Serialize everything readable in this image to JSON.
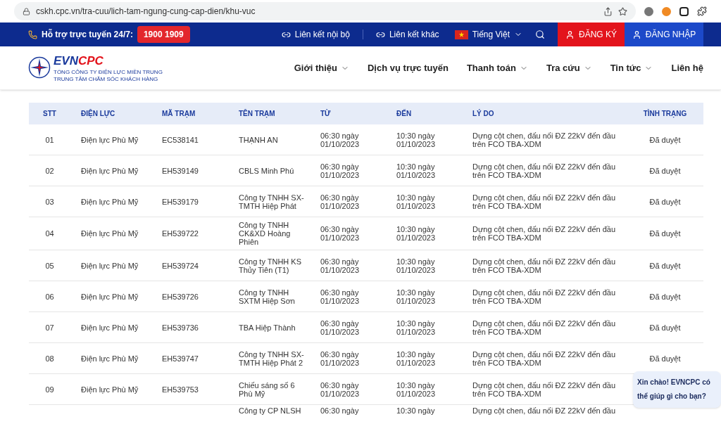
{
  "browser": {
    "url": "cskh.cpc.vn/tra-cuu/lich-tam-ngung-cung-cap-dien/khu-vuc"
  },
  "topbar": {
    "hotline_label": "Hỗ trợ trực tuyến 24/7:",
    "hotline_number": "1900 1909",
    "links": [
      "Liên kết nội bộ",
      "Liên kết khác"
    ],
    "language": "Tiếng Việt",
    "register": "ĐĂNG KÝ",
    "login": "ĐĂNG NHẬP"
  },
  "header": {
    "logo": {
      "brand_a": "EVN",
      "brand_b": "CPC",
      "line1": "TỔNG CÔNG TY ĐIỆN LỰC MIỀN TRUNG",
      "line2": "TRUNG TÂM CHĂM SÓC KHÁCH HÀNG"
    },
    "nav": [
      {
        "label": "Giới thiệu",
        "has_menu": true
      },
      {
        "label": "Dịch vụ trực tuyến",
        "has_menu": false
      },
      {
        "label": "Thanh toán",
        "has_menu": true
      },
      {
        "label": "Tra cứu",
        "has_menu": true
      },
      {
        "label": "Tin tức",
        "has_menu": true
      },
      {
        "label": "Liên hệ",
        "has_menu": false
      }
    ]
  },
  "table": {
    "columns": [
      "STT",
      "ĐIỆN LỰC",
      "MÃ TRẠM",
      "TÊN TRẠM",
      "TỪ",
      "ĐẾN",
      "LÝ DO",
      "TÌNH TRẠNG"
    ],
    "rows": [
      {
        "stt": "01",
        "unit": "Điện lực Phù Mỹ",
        "code": "EC538141",
        "name": "THẠNH AN",
        "from": "06:30 ngày 01/10/2023",
        "to": "10:30 ngày 01/10/2023",
        "reason": "Dựng cột chen, đấu nối ĐZ 22kV đến đầu trên FCO TBA-XDM",
        "status": "Đã duyệt"
      },
      {
        "stt": "02",
        "unit": "Điện lực Phù Mỹ",
        "code": "EH539149",
        "name": "CBLS Minh Phú",
        "from": "06:30 ngày 01/10/2023",
        "to": "10:30 ngày 01/10/2023",
        "reason": "Dựng cột chen, đấu nối ĐZ 22kV đến đầu trên FCO TBA-XDM",
        "status": "Đã duyệt"
      },
      {
        "stt": "03",
        "unit": "Điện lực Phù Mỹ",
        "code": "EH539179",
        "name": "Công ty TNHH SX-TMTH Hiệp Phát",
        "from": "06:30 ngày 01/10/2023",
        "to": "10:30 ngày 01/10/2023",
        "reason": "Dựng cột chen, đấu nối ĐZ 22kV đến đầu trên FCO TBA-XDM",
        "status": "Đã duyệt"
      },
      {
        "stt": "04",
        "unit": "Điện lực Phù Mỹ",
        "code": "EH539722",
        "name": "Công ty TNHH CK&XD Hoàng Phiên",
        "from": "06:30 ngày 01/10/2023",
        "to": "10:30 ngày 01/10/2023",
        "reason": "Dựng cột chen, đấu nối ĐZ 22kV đến đầu trên FCO TBA-XDM",
        "status": "Đã duyệt"
      },
      {
        "stt": "05",
        "unit": "Điện lực Phù Mỹ",
        "code": "EH539724",
        "name": "Công ty TNHH KS Thủy Tiên (T1)",
        "from": "06:30 ngày 01/10/2023",
        "to": "10:30 ngày 01/10/2023",
        "reason": "Dựng cột chen, đấu nối ĐZ 22kV đến đầu trên FCO TBA-XDM",
        "status": "Đã duyệt"
      },
      {
        "stt": "06",
        "unit": "Điện lực Phù Mỹ",
        "code": "EH539726",
        "name": "Công ty TNHH SXTM Hiệp Sơn",
        "from": "06:30 ngày 01/10/2023",
        "to": "10:30 ngày 01/10/2023",
        "reason": "Dựng cột chen, đấu nối ĐZ 22kV đến đầu trên FCO TBA-XDM",
        "status": "Đã duyệt"
      },
      {
        "stt": "07",
        "unit": "Điện lực Phù Mỹ",
        "code": "EH539736",
        "name": "TBA Hiệp Thành",
        "from": "06:30 ngày 01/10/2023",
        "to": "10:30 ngày 01/10/2023",
        "reason": "Dựng cột chen, đấu nối ĐZ 22kV đến đầu trên FCO TBA-XDM",
        "status": "Đã duyệt"
      },
      {
        "stt": "08",
        "unit": "Điện lực Phù Mỹ",
        "code": "EH539747",
        "name": "Công ty TNHH SX-TMTH Hiệp Phát 2",
        "from": "06:30 ngày 01/10/2023",
        "to": "10:30 ngày 01/10/2023",
        "reason": "Dựng cột chen, đấu nối ĐZ 22kV đến đầu trên FCO TBA-XDM",
        "status": "Đã duyệt"
      },
      {
        "stt": "09",
        "unit": "Điện lực Phù Mỹ",
        "code": "EH539753",
        "name": "Chiếu sáng số 6 Phù Mỹ",
        "from": "06:30 ngày 01/10/2023",
        "to": "10:30 ngày 01/10/2023",
        "reason": "Dựng cột chen, đấu nối ĐZ 22kV đến đầu trên FCO TBA-XDM"
      }
    ],
    "partial_row": {
      "name": "Công ty CP NLSH",
      "from": "06:30 ngày",
      "to": "10:30 ngày",
      "reason": "Dựng cột chen, đấu nối ĐZ 22kV đến đầu"
    }
  },
  "chat": {
    "message": "Xin chào! EVNCPC có thể giúp gì cho bạn?"
  }
}
